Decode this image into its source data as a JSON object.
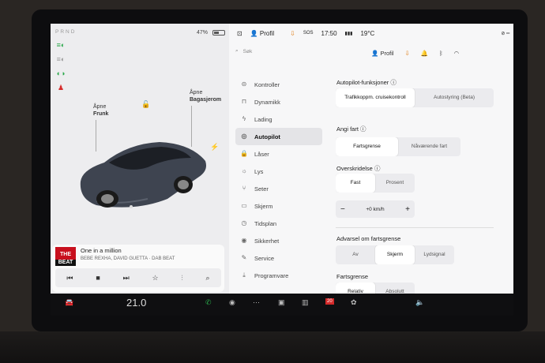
{
  "status": {
    "prnd": "PRND",
    "battery": "47%",
    "profile": "Profil",
    "time": "17:50",
    "temp": "19°C"
  },
  "car": {
    "frunk_line1": "Åpne",
    "frunk_line2": "Frunk",
    "trunk_line1": "Åpne",
    "trunk_line2": "Bagasjerom"
  },
  "media": {
    "logo_top": "THE",
    "logo_bottom": "BEAT",
    "song": "One in a million",
    "artist": "BEBE REXHA, DAVID GUETTA · DAB BEAT"
  },
  "settings": {
    "search_placeholder": "Søk",
    "profile": "Profil",
    "menu": [
      {
        "label": "Kontroller",
        "icon": "toggle-icon"
      },
      {
        "label": "Dynamikk",
        "icon": "car-icon"
      },
      {
        "label": "Lading",
        "icon": "bolt-icon"
      },
      {
        "label": "Autopilot",
        "icon": "steering-wheel-icon"
      },
      {
        "label": "Låser",
        "icon": "lock-icon"
      },
      {
        "label": "Lys",
        "icon": "light-icon"
      },
      {
        "label": "Seter",
        "icon": "seat-icon"
      },
      {
        "label": "Skjerm",
        "icon": "display-icon"
      },
      {
        "label": "Tidsplan",
        "icon": "clock-icon"
      },
      {
        "label": "Sikkerhet",
        "icon": "shield-icon"
      },
      {
        "label": "Service",
        "icon": "wrench-icon"
      },
      {
        "label": "Programvare",
        "icon": "download-icon"
      }
    ],
    "autopilot_title": "Autopilot-funksjoner",
    "ap_option1": "Trafikkoppm. cruisekontroll",
    "ap_option2": "Autostyring (Beta)",
    "speed_title": "Angi fart",
    "speed_opt1": "Fartsgrense",
    "speed_opt2": "Nåværende fart",
    "offset_title": "Overskridelse",
    "offset_opt1": "Fast",
    "offset_opt2": "Prosent",
    "offset_value": "+0 km/h",
    "warning_title": "Advarsel om fartsgrense",
    "warn_opt1": "Av",
    "warn_opt2": "Skjerm",
    "warn_opt3": "Lydsignal",
    "limit_title": "Fartsgrense",
    "limit_opt1": "Relativ",
    "limit_opt2": "Absolutt"
  },
  "taskbar": {
    "temp": "21.0",
    "calendar_day": "20"
  }
}
